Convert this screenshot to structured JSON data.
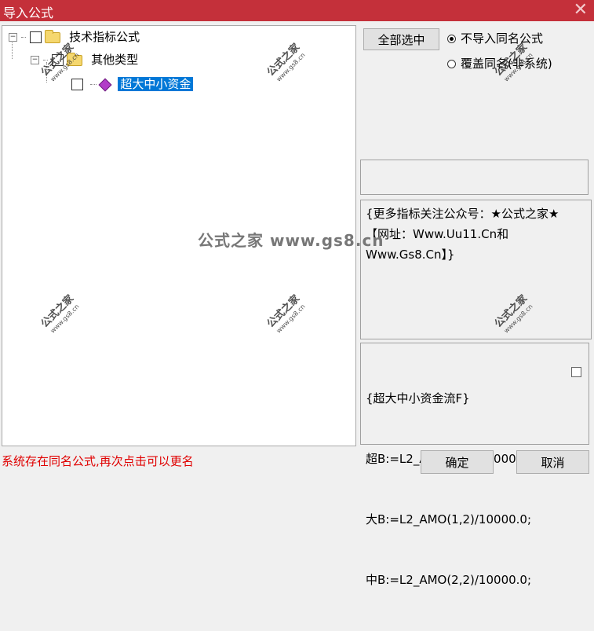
{
  "window": {
    "title": "导入公式"
  },
  "tree": {
    "root_label": "技术指标公式",
    "child_label": "其他类型",
    "leaf_label": "超大中小资金"
  },
  "buttons": {
    "select_all": "全部选中",
    "ok": "确定",
    "cancel": "取消"
  },
  "options": {
    "no_import_same": "不导入同名公式",
    "overwrite_same": "覆盖同名(非系统)",
    "selected": "no_import_same"
  },
  "info_text": "{更多指标关注公众号：★公式之家★ 【网址：Www.Uu11.Cn和Www.Gs8.Cn】}",
  "code_lines": [
    "{超大中小资金流F}",
    "超B:=L2_AMO(0,2)/10000.0;",
    "大B:=L2_AMO(1,2)/10000.0;",
    "中B:=L2_AMO(2,2)/10000.0;"
  ],
  "status_text": "系统存在同名公式,再次点击可以更名",
  "watermark": {
    "stamp_text": "公式之家",
    "stamp_url": "www.gs8.cn",
    "center_text": "公式之家 www.gs8.cn"
  }
}
